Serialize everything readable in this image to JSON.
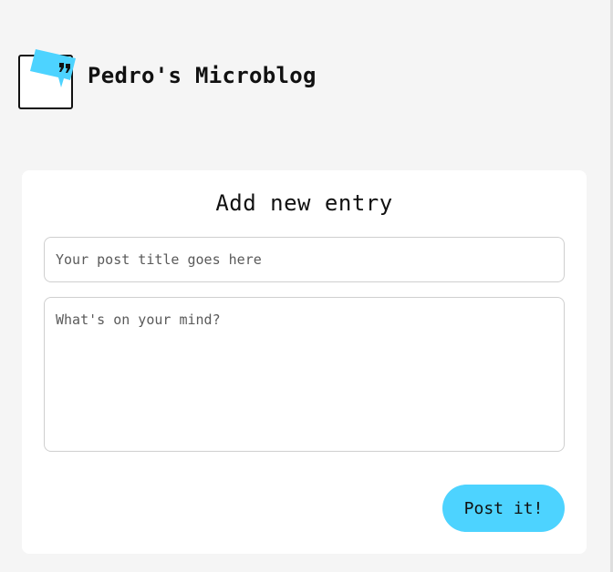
{
  "header": {
    "site_title": "Pedro's Microblog",
    "logo_icon": "speech-bubble-quote-icon",
    "accent_color": "#4dd3ff"
  },
  "form": {
    "heading": "Add new entry",
    "title_placeholder": "Your post title goes here",
    "title_value": "",
    "body_placeholder": "What's on your mind?",
    "body_value": "",
    "submit_label": "Post it!"
  }
}
